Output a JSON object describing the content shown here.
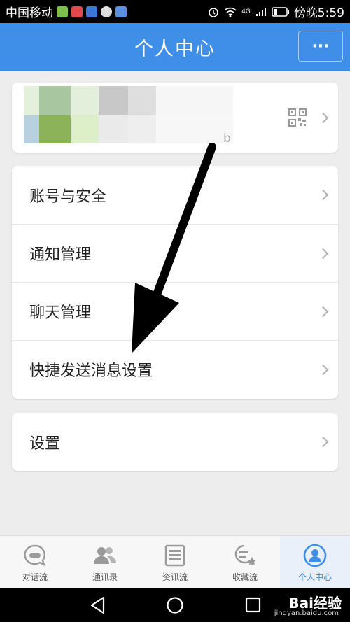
{
  "status": {
    "carrier": "中国移动",
    "network": "4G",
    "time": "傍晚5:59"
  },
  "header": {
    "title": "个人中心",
    "more": "···"
  },
  "profile": {
    "suffix": "b"
  },
  "menu": {
    "items": [
      "账号与安全",
      "通知管理",
      "聊天管理",
      "快捷发送消息设置"
    ]
  },
  "settings": {
    "label": "设置"
  },
  "tabbar": {
    "tabs": [
      "对话流",
      "通讯录",
      "资讯流",
      "收藏流",
      "个人中心"
    ]
  },
  "watermark": {
    "brand": "Bai经验",
    "site": "jingyan.baidu.com"
  },
  "colors": {
    "accent": "#3f8ee8",
    "background": "#ededed"
  }
}
